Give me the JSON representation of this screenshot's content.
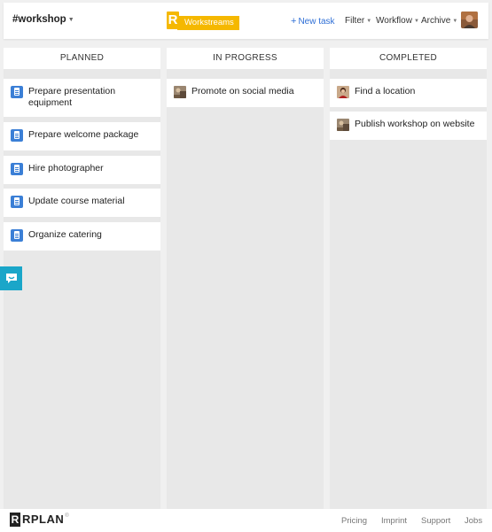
{
  "header": {
    "channel": "#workshop",
    "logo_letter": "R",
    "app_name": "Workstreams",
    "new_task_label": "New task",
    "menus": [
      "Filter",
      "Workflow",
      "Archive"
    ]
  },
  "columns": [
    {
      "title": "PLANNED",
      "cards": [
        {
          "text": "Prepare presentation equipment",
          "icon": "clipboard-icon"
        },
        {
          "text": "Prepare welcome package",
          "icon": "clipboard-icon"
        },
        {
          "text": "Hire photographer",
          "icon": "clipboard-icon"
        },
        {
          "text": "Update course material",
          "icon": "clipboard-icon"
        },
        {
          "text": "Organize catering",
          "icon": "clipboard-icon"
        }
      ]
    },
    {
      "title": "IN PROGRESS",
      "cards": [
        {
          "text": "Promote on social media",
          "icon": "photo-thumbnail"
        }
      ]
    },
    {
      "title": "COMPLETED",
      "cards": [
        {
          "text": "Find a location",
          "icon": "person-thumbnail"
        },
        {
          "text": "Publish workshop on website",
          "icon": "photo-thumbnail"
        }
      ]
    }
  ],
  "footer": {
    "logo_letter": "R",
    "brand": "RPLAN",
    "registered": "®",
    "links": [
      "Pricing",
      "Imprint",
      "Support",
      "Jobs"
    ]
  },
  "colors": {
    "accent_yellow": "#f5b800",
    "link_blue": "#2f6fd6",
    "icon_blue": "#3b7fd6",
    "feedback_teal": "#1aa6c9"
  }
}
